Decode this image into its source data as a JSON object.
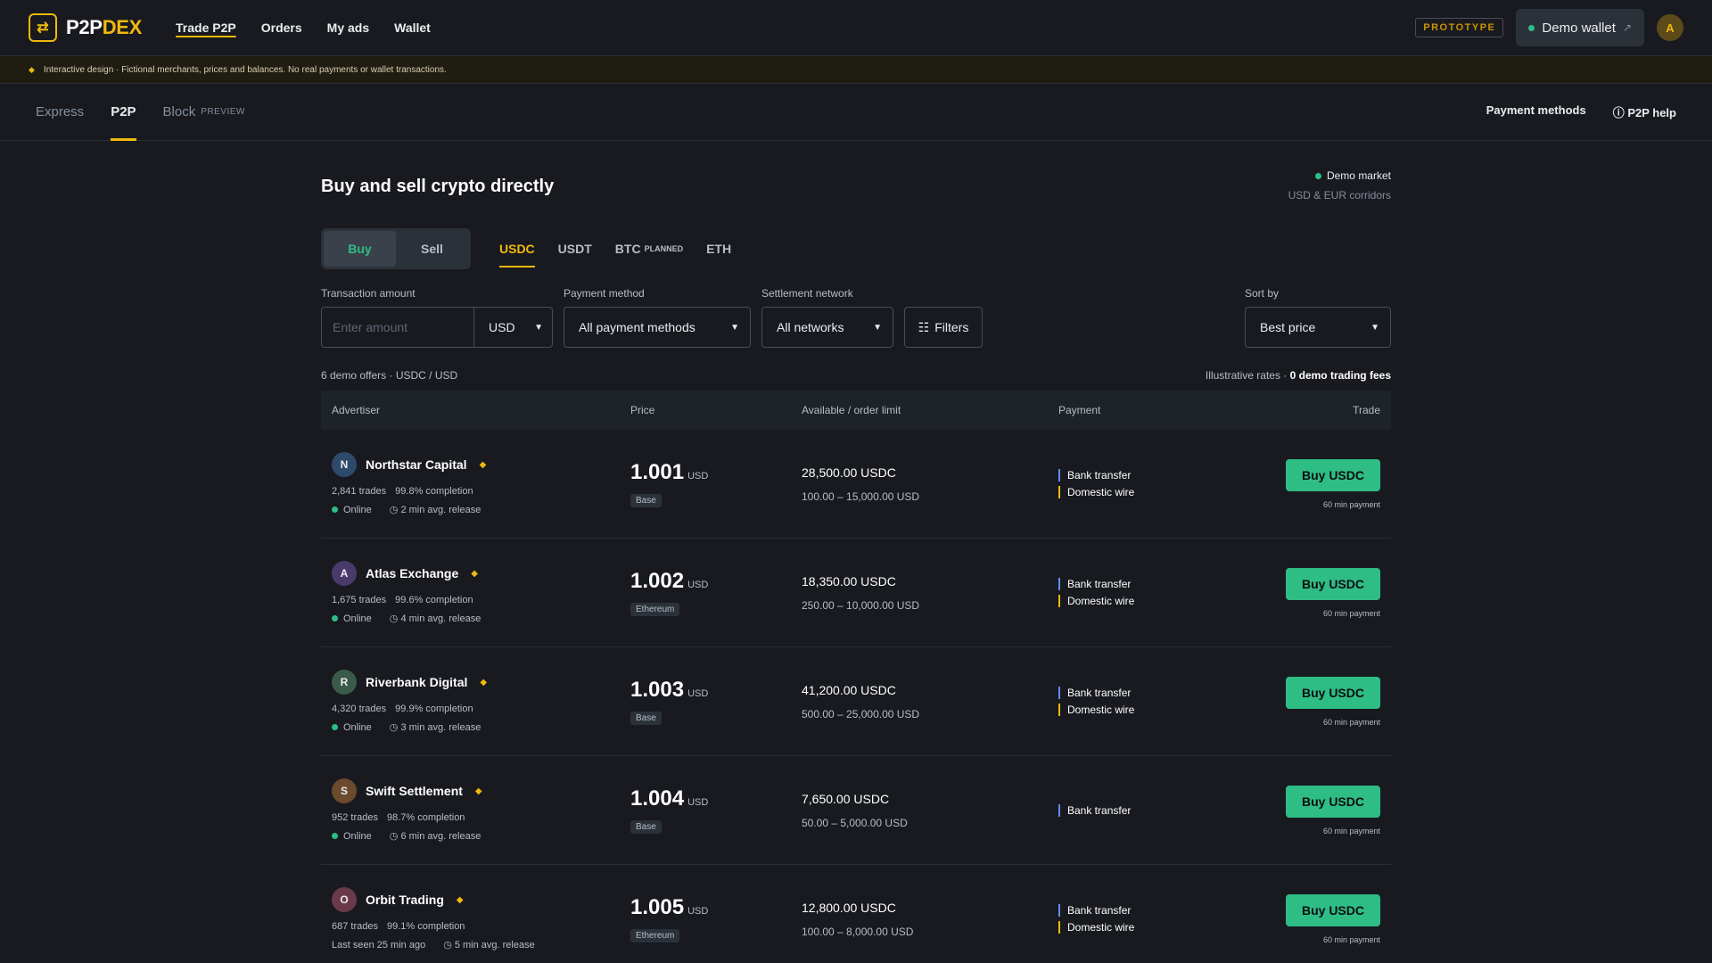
{
  "brand": {
    "logo_icon": "exchange-arrows-icon",
    "name_main": "P2P",
    "name_accent": "DEX"
  },
  "nav": {
    "items": [
      "Trade P2P",
      "Orders",
      "My ads",
      "Wallet"
    ]
  },
  "header_right": {
    "badge": "PROTOTYPE",
    "wallet_label": "Demo wallet",
    "wallet_icon": "external-link-icon",
    "avatar": "A"
  },
  "notice": "Interactive design · Fictional merchants, prices and balances. No real payments or wallet transactions.",
  "subnav": {
    "tabs": [
      "Express",
      "P2P",
      "Block"
    ],
    "block_badge": "PREVIEW",
    "right_links": [
      "Payment methods",
      "P2P help"
    ]
  },
  "page": {
    "title": "Buy and sell crypto directly",
    "market_status": "Demo market",
    "market_sub": "USD & EUR corridors"
  },
  "side_toggle": {
    "buy": "Buy",
    "sell": "Sell"
  },
  "coins": {
    "usdc": "USDC",
    "usdt": "USDT",
    "btc": "BTC",
    "btc_badge": "PLANNED",
    "eth": "ETH"
  },
  "filters": {
    "amount_label": "Transaction amount",
    "amount_placeholder": "Enter amount",
    "amount_currency": "USD",
    "payment_label": "Payment method",
    "payment_value": "All payment methods",
    "network_label": "Settlement network",
    "network_value": "All networks",
    "filters_button": "Filters",
    "sort_label": "Sort by",
    "sort_value": "Best price"
  },
  "meta": {
    "left": "6 demo offers · USDC / USD",
    "right_prefix": "Illustrative rates · ",
    "right_bold": "0 demo trading fees"
  },
  "table": {
    "headers": [
      "Advertiser",
      "Price",
      "Available / order limit",
      "Payment",
      "Trade"
    ],
    "rows": [
      {
        "initial": "N",
        "avatar_color": "#2e4a6b",
        "name": "Northstar Capital",
        "trades": "2,841 trades",
        "completion": "99.8% completion",
        "status": "Online",
        "release": "2 min avg. release",
        "price": "1.001",
        "price_cur": "USD",
        "network": "Base",
        "available": "28,500.00 USDC",
        "limit": "100.00 – 15,000.00 USD",
        "payments": [
          "Bank transfer",
          "Domestic wire"
        ],
        "button": "Buy USDC",
        "pay_time": "60 min payment"
      },
      {
        "initial": "A",
        "avatar_color": "#4a3a6b",
        "name": "Atlas Exchange",
        "trades": "1,675 trades",
        "completion": "99.6% completion",
        "status": "Online",
        "release": "4 min avg. release",
        "price": "1.002",
        "price_cur": "USD",
        "network": "Ethereum",
        "available": "18,350.00 USDC",
        "limit": "250.00 – 10,000.00 USD",
        "payments": [
          "Bank transfer",
          "Domestic wire"
        ],
        "button": "Buy USDC",
        "pay_time": "60 min payment"
      },
      {
        "initial": "R",
        "avatar_color": "#3a5a4a",
        "name": "Riverbank Digital",
        "trades": "4,320 trades",
        "completion": "99.9% completion",
        "status": "Online",
        "release": "3 min avg. release",
        "price": "1.003",
        "price_cur": "USD",
        "network": "Base",
        "available": "41,200.00 USDC",
        "limit": "500.00 – 25,000.00 USD",
        "payments": [
          "Bank transfer",
          "Domestic wire"
        ],
        "button": "Buy USDC",
        "pay_time": "60 min payment"
      },
      {
        "initial": "S",
        "avatar_color": "#6b4a2e",
        "name": "Swift Settlement",
        "trades": "952 trades",
        "completion": "98.7% completion",
        "status": "Online",
        "release": "6 min avg. release",
        "price": "1.004",
        "price_cur": "USD",
        "network": "Base",
        "available": "7,650.00 USDC",
        "limit": "50.00 – 5,000.00 USD",
        "payments": [
          "Bank transfer"
        ],
        "button": "Buy USDC",
        "pay_time": "60 min payment"
      },
      {
        "initial": "O",
        "avatar_color": "#6b3a4a",
        "name": "Orbit Trading",
        "trades": "687 trades",
        "completion": "99.1% completion",
        "status": "Last seen 25 min ago",
        "release": "5 min avg. release",
        "price": "1.005",
        "price_cur": "USD",
        "network": "Ethereum",
        "available": "12,800.00 USDC",
        "limit": "100.00 – 8,000.00 USD",
        "payments": [
          "Bank transfer",
          "Domestic wire"
        ],
        "button": "Buy USDC",
        "pay_time": "60 min payment"
      }
    ]
  },
  "colors": {
    "accent": "#f0b90b",
    "buy_green": "#2ebd85",
    "bg": "#181a20"
  }
}
